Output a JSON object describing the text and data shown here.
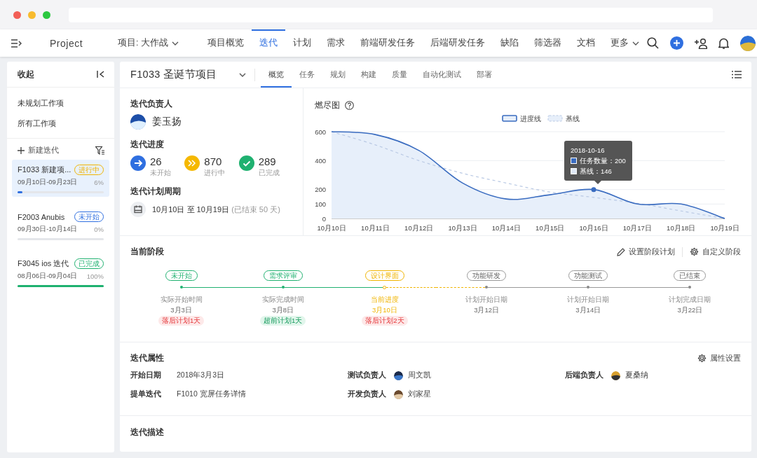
{
  "nav": {
    "brand": "Project",
    "project": "项目: 大作战",
    "more": "更多",
    "tabs": [
      {
        "label": "项目概览",
        "selected": false
      },
      {
        "label": "迭代",
        "selected": true
      },
      {
        "label": "计划",
        "selected": false
      },
      {
        "label": "需求",
        "selected": false
      },
      {
        "label": "前端研发任务",
        "selected": false
      },
      {
        "label": "后端研发任务",
        "selected": false
      },
      {
        "label": "缺陷",
        "selected": false
      },
      {
        "label": "筛选器",
        "selected": false
      },
      {
        "label": "文档",
        "selected": false
      }
    ]
  },
  "sidebar": {
    "collapse": "收起",
    "links": [
      "未规划工作项",
      "所有工作项"
    ],
    "new_iteration": "新建迭代",
    "iterations": [
      {
        "name": "F1033 新建项...",
        "status": "进行中",
        "color": "#f0b400",
        "dates": "09月10日-09月23日",
        "percent": "6%",
        "level": 0.06,
        "selected": true
      },
      {
        "name": "F2003 Anubis",
        "status": "未开始",
        "color": "#2f6fe0",
        "dates": "09月30日-10月14日",
        "percent": "0%",
        "level": 0,
        "selected": false
      },
      {
        "name": "F3045 ios 迭代",
        "status": "已完成",
        "color": "#1fb170",
        "dates": "08月06日-09月04日",
        "percent": "100%",
        "level": 1,
        "selected": false
      }
    ]
  },
  "iteration": {
    "title": "F1033 圣诞节项目",
    "tabs": [
      {
        "label": "概览",
        "selected": true
      },
      {
        "label": "任务",
        "selected": false
      },
      {
        "label": "规划",
        "selected": false
      },
      {
        "label": "构建",
        "selected": false
      },
      {
        "label": "质量",
        "selected": false
      },
      {
        "label": "自动化测试",
        "selected": false
      },
      {
        "label": "部署",
        "selected": false
      }
    ],
    "owner": {
      "heading": "迭代负责人",
      "name": "姜玉扬"
    },
    "progress": {
      "heading": "迭代进度",
      "counters": [
        {
          "kind": "not_started",
          "count": "26",
          "label": "未开始",
          "color": "#2f6fe0"
        },
        {
          "kind": "in_progress",
          "count": "870",
          "label": "进行中",
          "color": "#f5b800"
        },
        {
          "kind": "done",
          "count": "289",
          "label": "已完成",
          "color": "#1fb170"
        }
      ]
    },
    "period": {
      "heading": "迭代计划周期",
      "range": "10月10日 至 10月19日",
      "note": "(已结束 50 天)"
    },
    "burndown": {
      "title": "燃尽图",
      "chart_data": {
        "type": "line",
        "categories": [
          "10月10日",
          "10月11日",
          "10月12日",
          "10月13日",
          "10月14日",
          "10月15日",
          "10月16日",
          "10月17日",
          "10月18日",
          "10月19日"
        ],
        "series": [
          {
            "name": "进度线",
            "color": "#3a6cc0",
            "line_style": "solid",
            "values": [
              600,
              580,
              470,
              245,
              135,
              164,
              200,
              100,
              100,
              0
            ]
          },
          {
            "name": "基线",
            "color": "#b9c9e4",
            "line_style": "dashed",
            "values": [
              600,
              509,
              400,
              312,
              245,
              183,
              146,
              105,
              52,
              0
            ]
          }
        ],
        "ylim": [
          0,
          600
        ],
        "grid": true,
        "legend": "top",
        "yticks": [
          0,
          100,
          200,
          400,
          600
        ]
      },
      "tooltip": {
        "date": "2018-10-16",
        "lines": [
          "任务数量：200",
          "基线：146"
        ]
      }
    },
    "stages": {
      "heading": "当前阶段",
      "actions": [
        "设置阶段计划",
        "自定义阶段"
      ],
      "items": [
        {
          "label": "未开始",
          "done": true,
          "current": false,
          "caption": "实际开始时间",
          "date": "3月3日",
          "badge": "落后计划1天",
          "late": true
        },
        {
          "label": "需求评审",
          "done": true,
          "current": false,
          "caption": "实际完成时间",
          "date": "3月8日",
          "badge": "超前计划1天",
          "late": false
        },
        {
          "label": "设计界面",
          "done": false,
          "current": true,
          "caption": "当前进度",
          "date": "3月10日",
          "badge": "落后计划2天",
          "late": true
        },
        {
          "label": "功能研发",
          "done": false,
          "current": false,
          "caption": "计划开始日期",
          "date": "3月12日"
        },
        {
          "label": "功能测试",
          "done": false,
          "current": false,
          "caption": "计划开始日期",
          "date": "3月14日"
        },
        {
          "label": "已结束",
          "done": false,
          "current": false,
          "caption": "计划完成日期",
          "date": "3月22日"
        }
      ]
    },
    "attributes": {
      "heading": "迭代属性",
      "action": "属性设置",
      "fields": [
        {
          "label": "开始日期",
          "value": "2018年3月3日",
          "kind": "text"
        },
        {
          "label": "测试负责人",
          "value": "周文凯",
          "kind": "person"
        },
        {
          "label": "后端负责人",
          "value": "夏桑纳",
          "kind": "person"
        },
        {
          "label": "提单迭代",
          "value": "F1010 宽屏任务详情",
          "kind": "text"
        },
        {
          "label": "开发负责人",
          "value": "刘家星",
          "kind": "person"
        }
      ]
    },
    "description": {
      "heading": "迭代描述"
    }
  }
}
